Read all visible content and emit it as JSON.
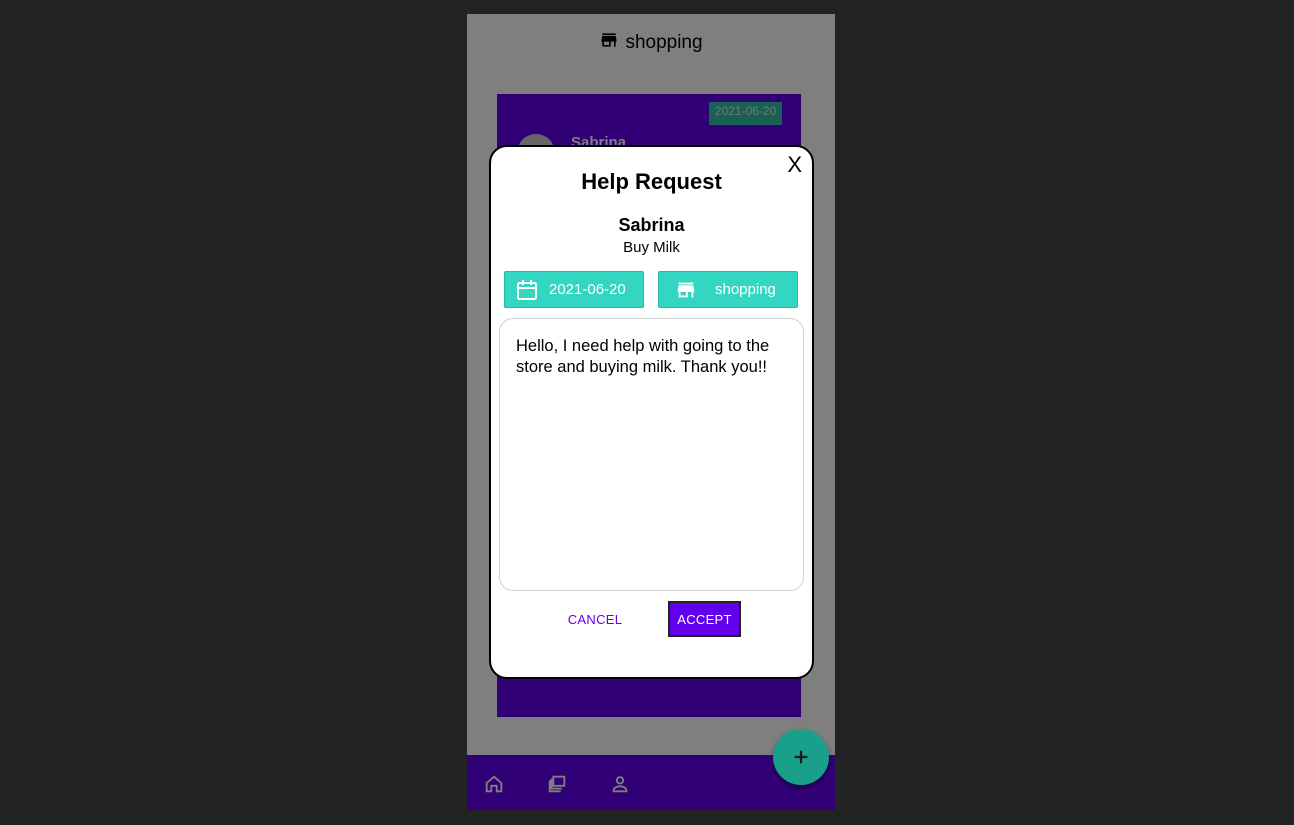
{
  "header": {
    "title": "shopping",
    "icon": "store-icon"
  },
  "card": {
    "date": "2021-06-20",
    "name": "Sabrina"
  },
  "bottom_nav": {
    "items": [
      "home-icon",
      "collections-icon",
      "person-icon"
    ]
  },
  "fab": {
    "icon": "add-icon"
  },
  "modal": {
    "close_label": "X",
    "title": "Help Request",
    "name": "Sabrina",
    "subtitle": "Buy Milk",
    "date_chip": "2021-06-20",
    "category_chip": "shopping",
    "message": "Hello, I need help with going to the store and buying milk. Thank you!!",
    "cancel_label": "CANCEL",
    "accept_label": "ACCEPT"
  },
  "colors": {
    "primary": "#6200ee",
    "teal": "#33d6c0",
    "fab": "#1aa08a",
    "background": "#232323"
  }
}
